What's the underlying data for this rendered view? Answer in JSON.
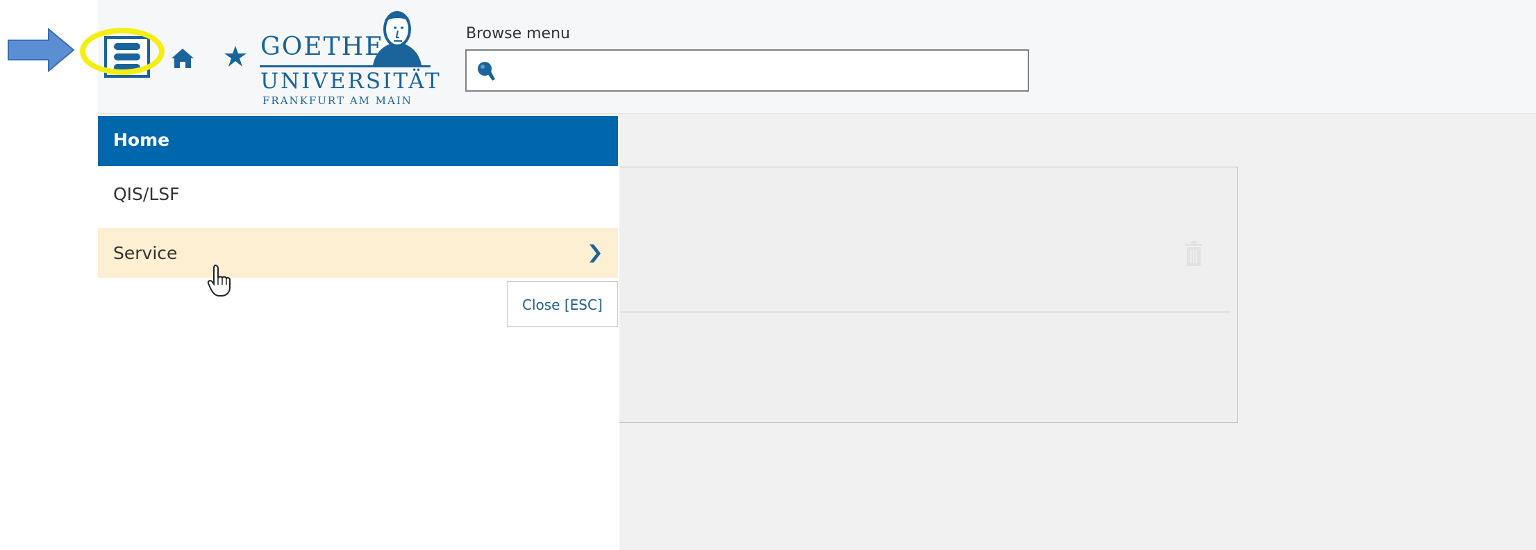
{
  "header": {
    "search_label": "Browse menu",
    "search_value": "",
    "logo": {
      "line1": "GOETHE",
      "line2": "UNIVERSITÄT",
      "line3": "FRANKFURT AM MAIN"
    }
  },
  "menu": {
    "title": "Home",
    "items": [
      {
        "label": "QIS/LSF"
      },
      {
        "label": "Service"
      }
    ],
    "close_label": "Close [ESC]"
  },
  "colors": {
    "primary_blue": "#0067ad",
    "hover_item": "#fdefd1",
    "highlight_ring": "#f5ee12",
    "annotation_arrow": "#5b8fd4"
  },
  "icons": [
    "menu-toggle-icon",
    "home-icon",
    "star-icon",
    "search-icon",
    "chevron-right-icon",
    "trash-icon",
    "pointer-cursor-icon",
    "annotation-arrow"
  ]
}
